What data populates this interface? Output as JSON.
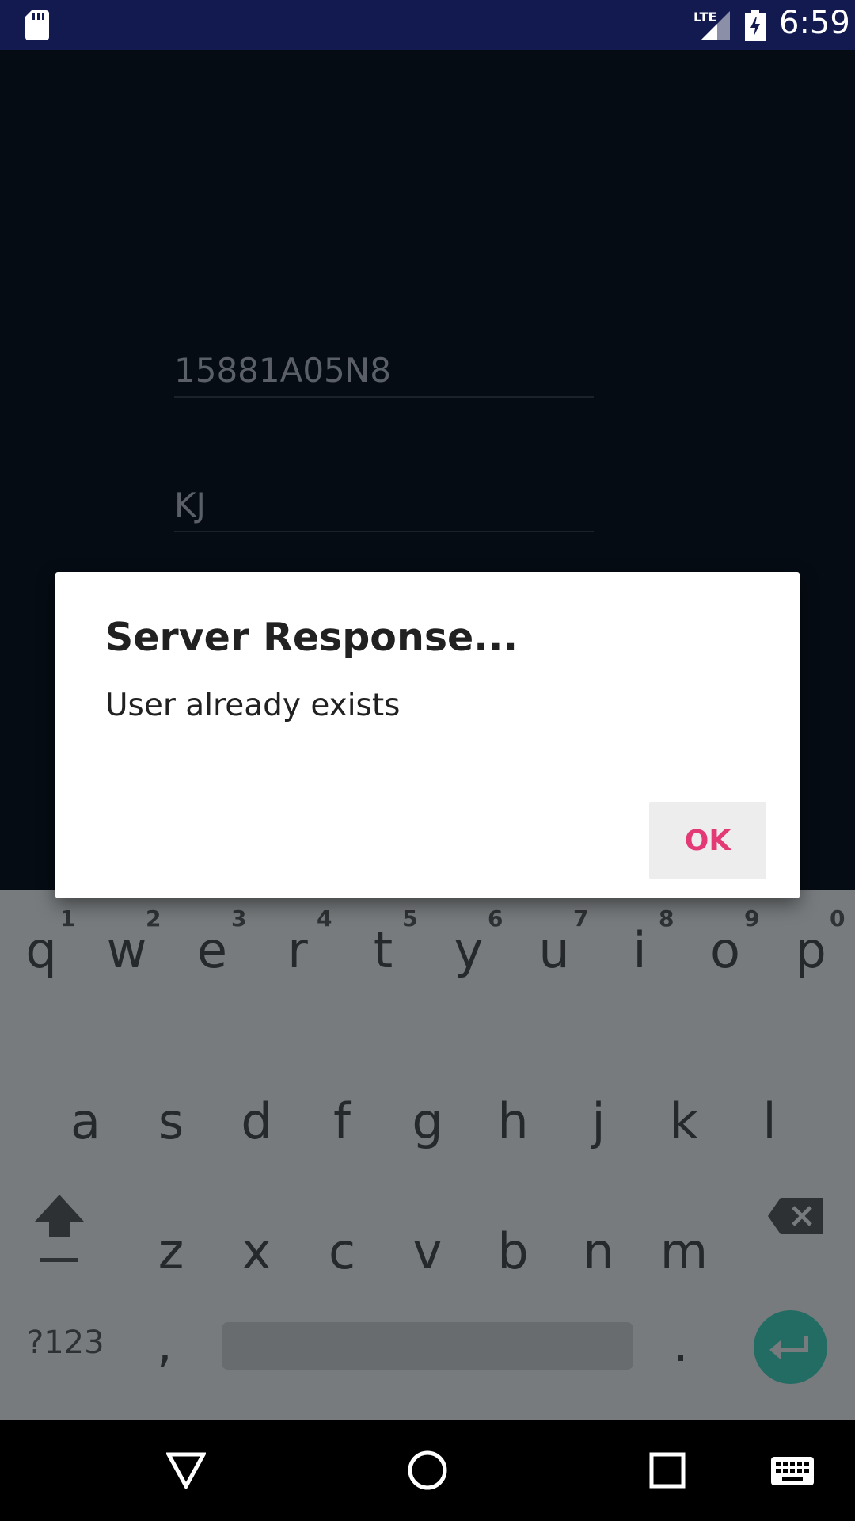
{
  "status_bar": {
    "time": "6:59",
    "network": "LTE"
  },
  "form": {
    "id_value": "15881A05N8",
    "name_value": "KJ"
  },
  "dialog": {
    "title": "Server Response...",
    "message": "User already exists",
    "ok_label": "OK",
    "ok_color": "#e33a75"
  },
  "keyboard": {
    "row1": [
      {
        "key": "q",
        "hint": "1"
      },
      {
        "key": "w",
        "hint": "2"
      },
      {
        "key": "e",
        "hint": "3"
      },
      {
        "key": "r",
        "hint": "4"
      },
      {
        "key": "t",
        "hint": "5"
      },
      {
        "key": "y",
        "hint": "6"
      },
      {
        "key": "u",
        "hint": "7"
      },
      {
        "key": "i",
        "hint": "8"
      },
      {
        "key": "o",
        "hint": "9"
      },
      {
        "key": "p",
        "hint": "0"
      }
    ],
    "row2": [
      "a",
      "s",
      "d",
      "f",
      "g",
      "h",
      "j",
      "k",
      "l"
    ],
    "row3": [
      "z",
      "x",
      "c",
      "v",
      "b",
      "n",
      "m"
    ],
    "symbols_label": "?123",
    "comma": ",",
    "period": "."
  },
  "icons": {
    "sd_card": "sd-card-icon",
    "signal": "signal-icon",
    "battery": "battery-charging-icon",
    "back": "back-icon",
    "home": "home-icon",
    "recents": "recents-icon",
    "keyboard_switch": "keyboard-icon",
    "shift": "shift-icon",
    "backspace": "backspace-icon",
    "enter": "enter-icon"
  }
}
